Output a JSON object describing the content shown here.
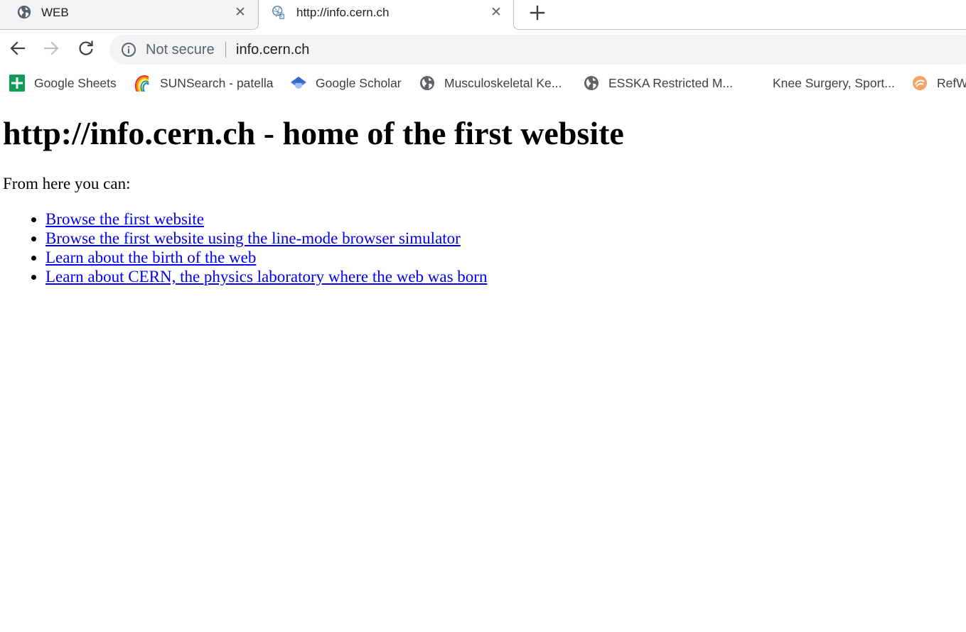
{
  "tabs": [
    {
      "title": "WEB",
      "active": false,
      "icon": "globe-icon"
    },
    {
      "title": "http://info.cern.ch",
      "active": true,
      "icon": "cern-favicon-icon"
    }
  ],
  "tab_close_glyph": "✕",
  "toolbar": {
    "back_icon": "back-arrow-icon",
    "forward_icon": "forward-arrow-icon",
    "reload_icon": "reload-icon"
  },
  "omnibox": {
    "security_label": "Not secure",
    "url": "info.cern.ch",
    "security_icon": "info-circle-icon"
  },
  "bookmarks": [
    {
      "label": "Google Sheets",
      "icon": "google-sheets-icon"
    },
    {
      "label": "SUNSearch - patella",
      "icon": "sunsearch-rainbow-icon"
    },
    {
      "label": "Google Scholar",
      "icon": "google-scholar-icon"
    },
    {
      "label": "Musculoskeletal Ke...",
      "icon": "globe-icon"
    },
    {
      "label": "ESSKA Restricted M...",
      "icon": "globe-icon"
    },
    {
      "label": "Knee Surgery, Sport...",
      "icon": "none"
    },
    {
      "label": "RefW",
      "icon": "refworks-icon"
    }
  ],
  "page": {
    "heading": "http://info.cern.ch - home of the first website",
    "intro": "From here you can:",
    "links": [
      "Browse the first website",
      "Browse the first website using the line-mode browser simulator",
      "Learn about the birth of the web",
      "Learn about CERN, the physics laboratory where the web was born"
    ]
  },
  "colors": {
    "link": "#0000ee",
    "tab_inactive_bg": "#f1f3f4",
    "omnibox_bg": "#f1f3f4",
    "icon_grey": "#5f6368"
  }
}
